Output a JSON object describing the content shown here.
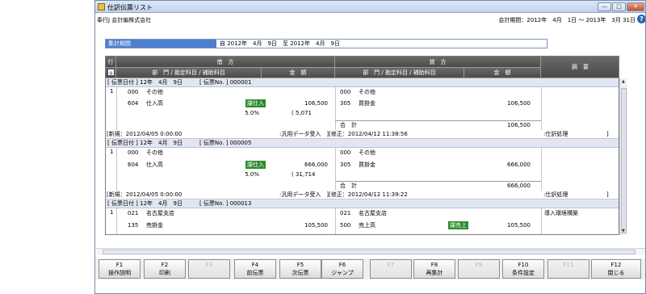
{
  "window": {
    "title": "仕訳伝票リスト",
    "minimize": "—",
    "maximize": "□",
    "close": "✕"
  },
  "info": {
    "company": "奉行J 会計編株式会社",
    "period": "会計期間：2012年　4月　1日 ～ 2013年　3月 31日",
    "help": "?"
  },
  "filter": {
    "label": "集計期間",
    "value": "自 2012年　4月　9日　至 2012年　4月　9日"
  },
  "headers": {
    "row": "行",
    "plus": "+",
    "debit": "借　方",
    "credit": "貸　方",
    "debit_account": "部　門 / 勘定科目 / 補助科目",
    "debit_amount": "金　額",
    "credit_account": "部　門 / 勘定科目 / 補助科目",
    "credit_amount": "金　額",
    "memo": "摘　要"
  },
  "vouchers": [
    {
      "header": "[ 伝票日付 ] 12年　4月　9日　　　[ 伝票No. ] 000001",
      "row": "1",
      "debit_dept_code": "000",
      "debit_dept": "その他",
      "debit_acct_code": "604",
      "debit_acct": "仕入高",
      "debit_tag": "課仕入",
      "debit_amount": "106,500",
      "debit_rate": "5.0%",
      "debit_tax": "( 5,071",
      "credit_dept_code": "000",
      "credit_dept": "その他",
      "credit_acct_code": "305",
      "credit_acct": "買掛金",
      "credit_tag": "",
      "credit_amount": "106,500",
      "memo": "",
      "total_label": "合　計",
      "total_amount": "106,500",
      "status_created": "[新規：2012/04/05  0:00:00",
      "status_import": ":汎用データ受入　][修正：2012/04/12  11:38:56",
      "status_process": ":仕訳処理",
      "status_end": "]"
    },
    {
      "header": "[ 伝票日付 ] 12年　4月　9日　　　[ 伝票No. ] 000005",
      "row": "1",
      "debit_dept_code": "000",
      "debit_dept": "その他",
      "debit_acct_code": "604",
      "debit_acct": "仕入高",
      "debit_tag": "課仕入",
      "debit_amount": "666,000",
      "debit_rate": "5.0%",
      "debit_tax": "( 31,714",
      "credit_dept_code": "000",
      "credit_dept": "その他",
      "credit_acct_code": "305",
      "credit_acct": "買掛金",
      "credit_tag": "",
      "credit_amount": "666,000",
      "memo": "",
      "total_label": "合　計",
      "total_amount": "666,000",
      "status_created": "[新規：2012/04/05  0:00:00",
      "status_import": ":汎用データ受入　][修正：2012/04/12  11:39:22",
      "status_process": ":仕訳処理",
      "status_end": "]"
    },
    {
      "header": "[ 伝票日付 ] 12年　4月　9日　　　[ 伝票No. ] 000013",
      "row": "1",
      "debit_dept_code": "021",
      "debit_dept": "名古屋支店",
      "debit_acct_code": "135",
      "debit_acct": "売掛金",
      "debit_tag": "",
      "debit_amount": "105,500",
      "credit_dept_code": "021",
      "credit_dept": "名古屋支店",
      "credit_acct_code": "500",
      "credit_acct": "売上高",
      "credit_tag": "課売上",
      "credit_amount": "105,500",
      "memo": "導入環境構築"
    }
  ],
  "fkeys": [
    {
      "key": "F1",
      "label": "操作説明",
      "enabled": true
    },
    {
      "key": "F2",
      "label": "印刷",
      "enabled": true
    },
    {
      "key": "F3",
      "label": "",
      "enabled": false
    },
    {
      "key": "F4",
      "label": "前伝票",
      "enabled": true
    },
    {
      "key": "F5",
      "label": "次伝票",
      "enabled": true
    },
    {
      "key": "F6",
      "label": "ジャンプ",
      "enabled": true
    },
    {
      "key": "F7",
      "label": "",
      "enabled": false
    },
    {
      "key": "F8",
      "label": "再集計",
      "enabled": true
    },
    {
      "key": "F9",
      "label": "",
      "enabled": false
    },
    {
      "key": "F10",
      "label": "条件設定",
      "enabled": true
    },
    {
      "key": "F11",
      "label": "",
      "enabled": false
    },
    {
      "key": "F12",
      "label": "閉じる",
      "enabled": true
    }
  ],
  "colors": {
    "accent": "#4d7fcc",
    "header_bg": "#5a5a5a",
    "tax_tag": "#2f8a2f",
    "voucher_head_bg": "#e1e6f2"
  }
}
